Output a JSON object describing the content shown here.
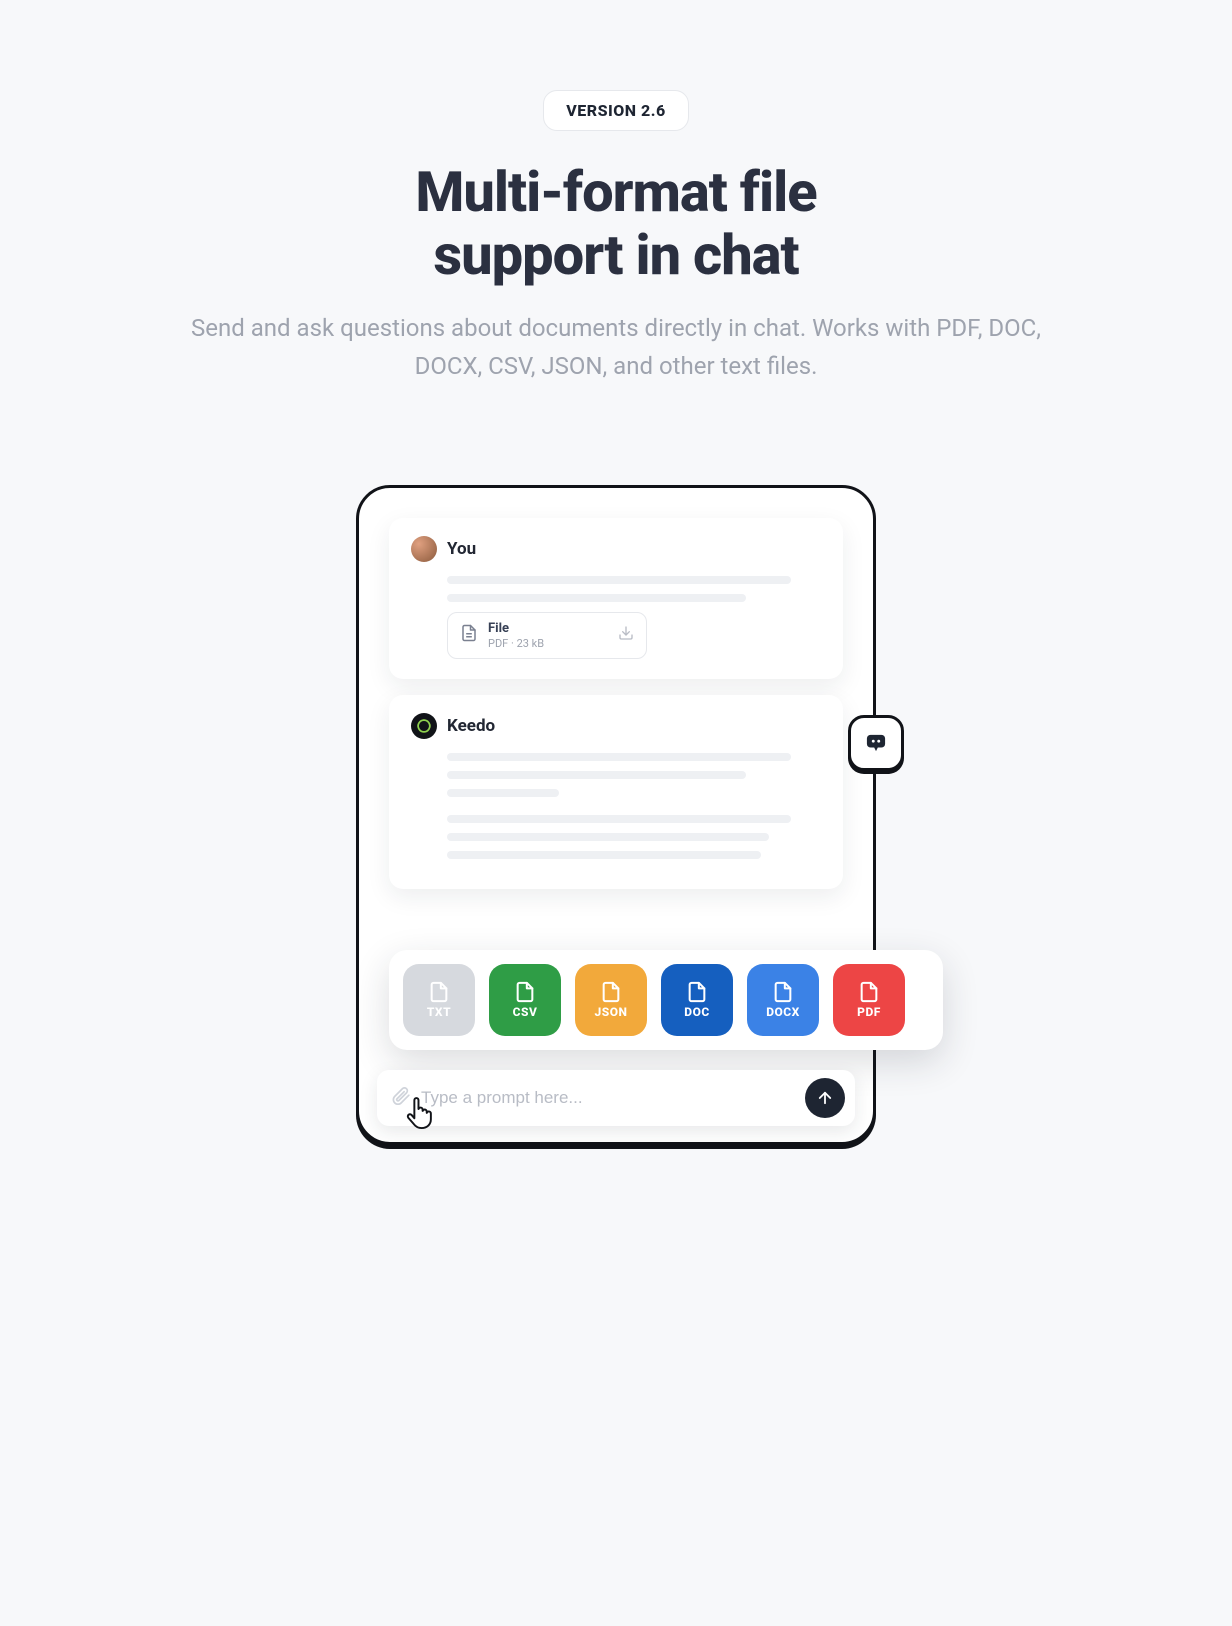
{
  "badge": "VERSION 2.6",
  "title_line1": "Multi-format file",
  "title_line2": "support in chat",
  "subtitle": "Send and ask questions about documents directly in chat. Works with PDF, DOC, DOCX, CSV, JSON, and other text files.",
  "chat": {
    "user_label": "You",
    "bot_label": "Keedo",
    "file": {
      "name": "File",
      "meta": "PDF · 23 kB"
    }
  },
  "formats": {
    "txt": "TXT",
    "csv": "CSV",
    "json": "JSON",
    "doc": "DOC",
    "docx": "DOCX",
    "pdf": "PDF"
  },
  "composer": {
    "placeholder": "Type a prompt here..."
  }
}
